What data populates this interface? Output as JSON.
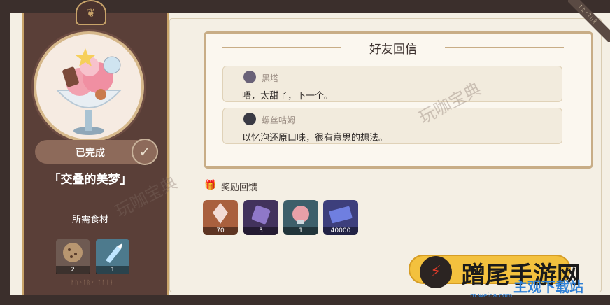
{
  "left_panel": {
    "status": "已完成",
    "dish_name": "「交叠的美梦」",
    "required_label": "所需食材",
    "ingredients": [
      {
        "name": "cookie-ingredient",
        "count": "2"
      },
      {
        "name": "crystal-ingredient",
        "count": "1"
      }
    ],
    "footer_rune": "ᚠᚢᚦᚨᚱᚲ ᛏᚨᛁᚾ"
  },
  "reply": {
    "title": "好友回信",
    "messages": [
      {
        "sender": "黑塔",
        "text": "唔，太甜了，下一个。"
      },
      {
        "sender": "螺丝咕姆",
        "text": "以忆泡还原口味，很有意思的想法。"
      }
    ]
  },
  "rewards": {
    "label": "奖励回馈",
    "items": [
      {
        "name": "crystal-reward",
        "count": "70"
      },
      {
        "name": "material-reward",
        "count": "3"
      },
      {
        "name": "food-reward",
        "count": "1"
      },
      {
        "name": "credit-reward",
        "count": "40000"
      }
    ]
  },
  "corner_tag": "ᚨᚱᚲᛏᚢᚱ",
  "watermark": {
    "big": "蹭尾手游网",
    "small": "主观下载站",
    "url": "m.weida.com",
    "faint": "玩咖宝典"
  },
  "colors": {
    "accent": "#c8ad86",
    "panel": "#5a3f38",
    "button": "#f3c13e"
  }
}
